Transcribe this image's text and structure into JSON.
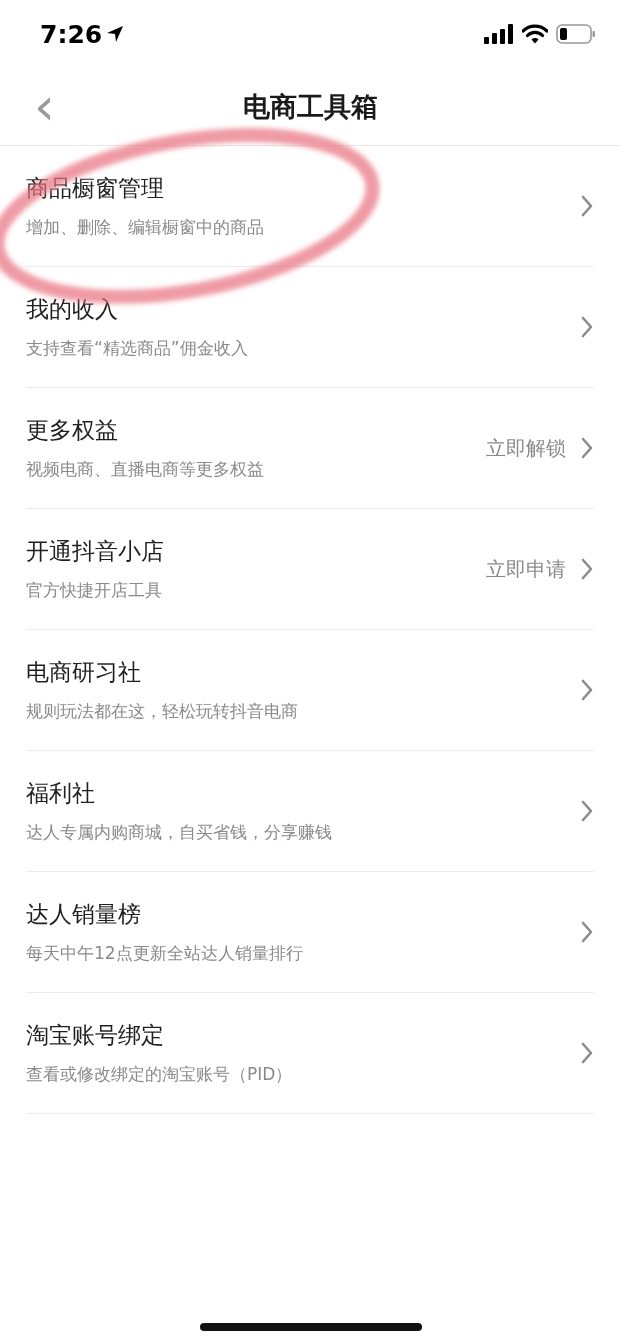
{
  "status_bar": {
    "time": "7:26"
  },
  "nav": {
    "back": "‹",
    "title": "电商工具箱"
  },
  "items": [
    {
      "title": "商品橱窗管理",
      "subtitle": "增加、删除、编辑橱窗中的商品",
      "highlighted": true
    },
    {
      "title": "我的收入",
      "subtitle": "支持查看“精选商品”佣金收入",
      "highlighted": false
    },
    {
      "title": "更多权益",
      "subtitle": "视频电商、直播电商等更多权益",
      "action": "立即解锁",
      "highlighted": false
    },
    {
      "title": "开通抖音小店",
      "subtitle": "官方快捷开店工具",
      "action": "立即申请",
      "highlighted": false
    },
    {
      "title": "电商研习社",
      "subtitle": "规则玩法都在这，轻松玩转抖音电商",
      "highlighted": false
    },
    {
      "title": "福利社",
      "subtitle": "达人专属内购商城，自买省钱，分享赚钱",
      "highlighted": false
    },
    {
      "title": "达人销量榜",
      "subtitle": "每天中午12点更新全站达人销量排行",
      "highlighted": false
    },
    {
      "title": "淘宝账号绑定",
      "subtitle": "查看或修改绑定的淘宝账号（PID）",
      "highlighted": false
    }
  ]
}
